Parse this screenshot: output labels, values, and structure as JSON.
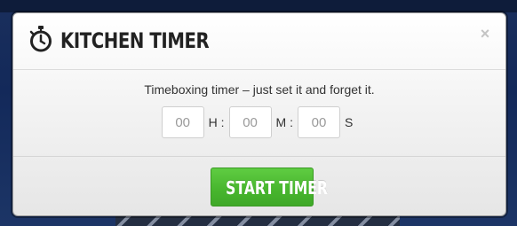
{
  "modal": {
    "title": "KITCHEN TIMER",
    "close_label": "×",
    "description": "Timeboxing timer – just set it and forget it.",
    "hours": {
      "value": "",
      "placeholder": "00",
      "unit": "H :"
    },
    "minutes": {
      "value": "",
      "placeholder": "00",
      "unit": "M :"
    },
    "seconds": {
      "value": "",
      "placeholder": "00",
      "unit": "S"
    },
    "start_label": "START TIMER"
  },
  "colors": {
    "accent_green": "#47b52d",
    "backdrop_blue": "#142c5e"
  },
  "icons": {
    "title_icon": "stopwatch-icon",
    "close_icon": "close-icon"
  }
}
